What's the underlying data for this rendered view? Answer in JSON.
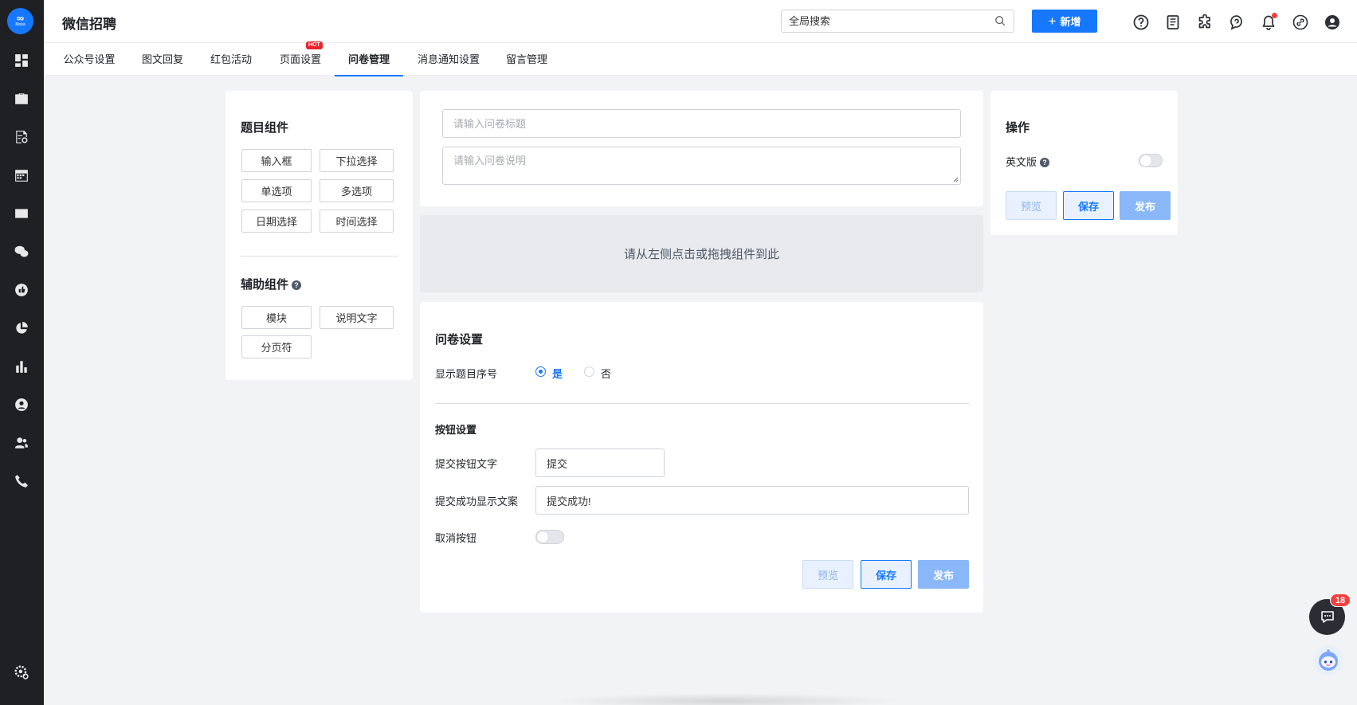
{
  "app": {
    "title": "微信招聘",
    "logo_text": "∞",
    "logo_sub": "Moka"
  },
  "header": {
    "search_placeholder": "全局搜索",
    "new_button": "新增"
  },
  "tabs": [
    {
      "label": "公众号设置"
    },
    {
      "label": "图文回复"
    },
    {
      "label": "红包活动"
    },
    {
      "label": "页面设置",
      "badge": "HOT"
    },
    {
      "label": "问卷管理",
      "active": true
    },
    {
      "label": "消息通知设置"
    },
    {
      "label": "留言管理"
    }
  ],
  "left_panel": {
    "question_title": "题目组件",
    "question_components": [
      "输入框",
      "下拉选择",
      "单选项",
      "多选项",
      "日期选择",
      "时间选择"
    ],
    "aux_title": "辅助组件",
    "aux_components": [
      "模块",
      "说明文字",
      "分页符"
    ]
  },
  "form": {
    "title_placeholder": "请输入问卷标题",
    "desc_placeholder": "请输入问卷说明",
    "dropzone_text": "请从左侧点击或拖拽组件到此"
  },
  "settings": {
    "title": "问卷设置",
    "show_number_label": "显示题目序号",
    "yes": "是",
    "no": "否",
    "show_number_value": "是",
    "button_section": "按钮设置",
    "submit_text_label": "提交按钮文字",
    "submit_text_value": "提交",
    "success_text_label": "提交成功显示文案",
    "success_text_value": "提交成功!",
    "cancel_label": "取消按钮",
    "cancel_enabled": false
  },
  "actions": {
    "title": "操作",
    "english_label": "英文版",
    "english_enabled": false,
    "preview": "预览",
    "save": "保存",
    "publish": "发布"
  },
  "chat": {
    "unread": "18"
  },
  "colors": {
    "primary": "#1677ff",
    "sidebar": "#1f2023",
    "hot": "#e8242b",
    "badge": "#f53f3f"
  }
}
